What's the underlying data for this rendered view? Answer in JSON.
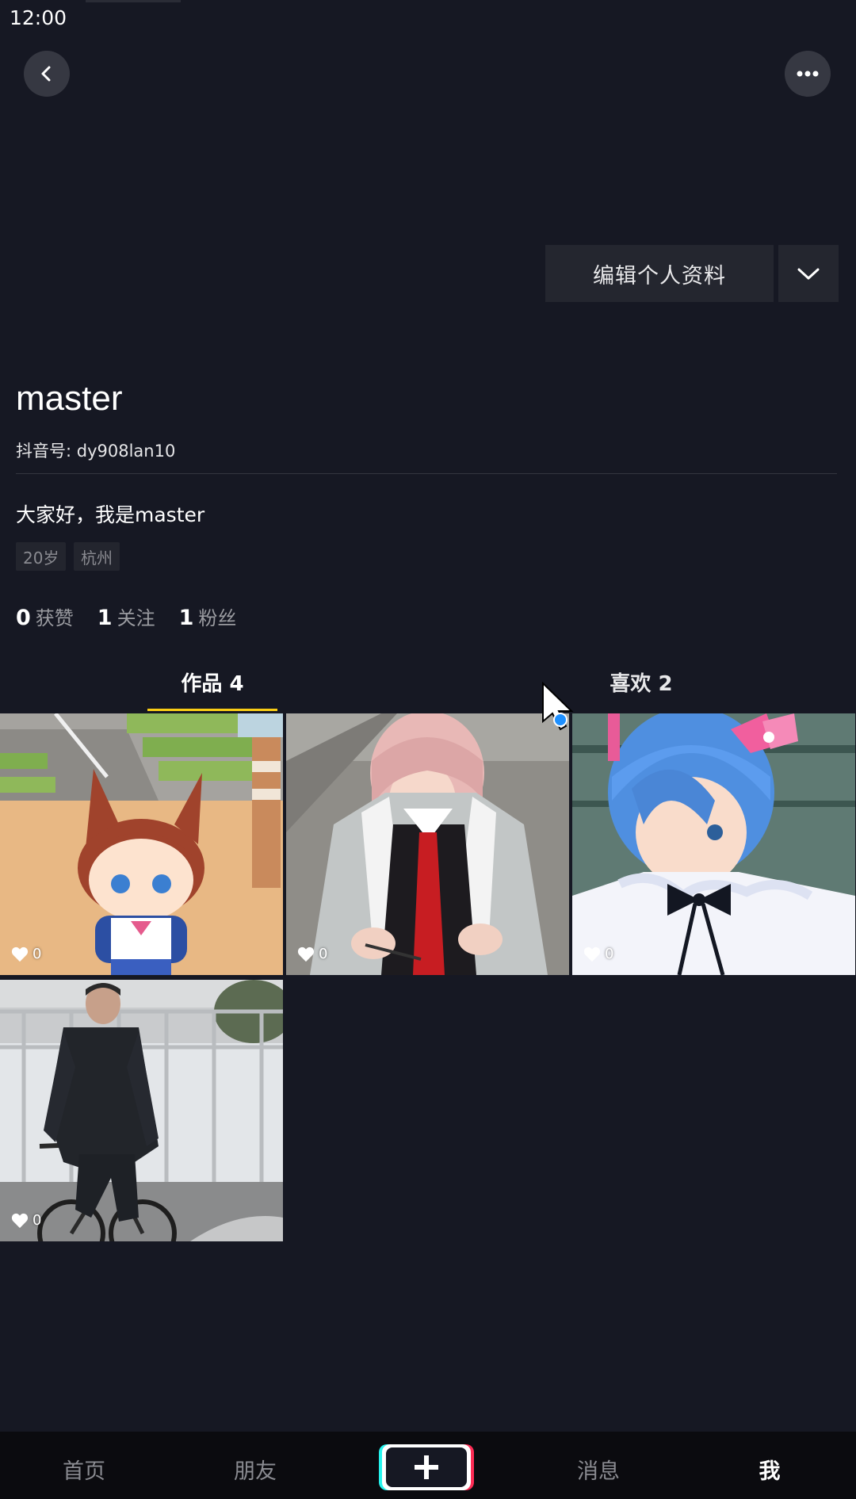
{
  "status_bar": {
    "time": "12:00"
  },
  "header": {
    "back_icon": "chevron-left-icon",
    "more_icon": "more-dots-icon"
  },
  "profile": {
    "edit_button_label": "编辑个人资料",
    "dropdown_icon": "chevron-down-icon",
    "nickname": "master",
    "douyin_id": "抖音号: dy908lan10",
    "bio": "大家好，我是master",
    "tags": [
      "20岁",
      "杭州"
    ],
    "stats": [
      {
        "value": "0",
        "label": "获赞"
      },
      {
        "value": "1",
        "label": "关注"
      },
      {
        "value": "1",
        "label": "粉丝"
      }
    ]
  },
  "tabs": [
    {
      "label": "作品 4",
      "active": true
    },
    {
      "label": "喜欢 2",
      "active": false
    }
  ],
  "videos": [
    {
      "likes": "0",
      "subject": "anime-chibi-horse-girl"
    },
    {
      "likes": "0",
      "subject": "cosplay-pink-hair-red-tie"
    },
    {
      "likes": "0",
      "subject": "cosplay-blue-hair-maid"
    },
    {
      "likes": "0",
      "subject": "man-on-bicycle"
    }
  ],
  "bottom_nav": {
    "items": [
      {
        "label": "首页"
      },
      {
        "label": "朋友"
      },
      {
        "label": "消息"
      },
      {
        "label": "我"
      }
    ],
    "plus_icon": "plus-icon"
  },
  "colors": {
    "background": "#161823",
    "accent_underline": "#face15",
    "plus_cyan": "#25f4ee",
    "plus_red": "#fe2c55"
  }
}
